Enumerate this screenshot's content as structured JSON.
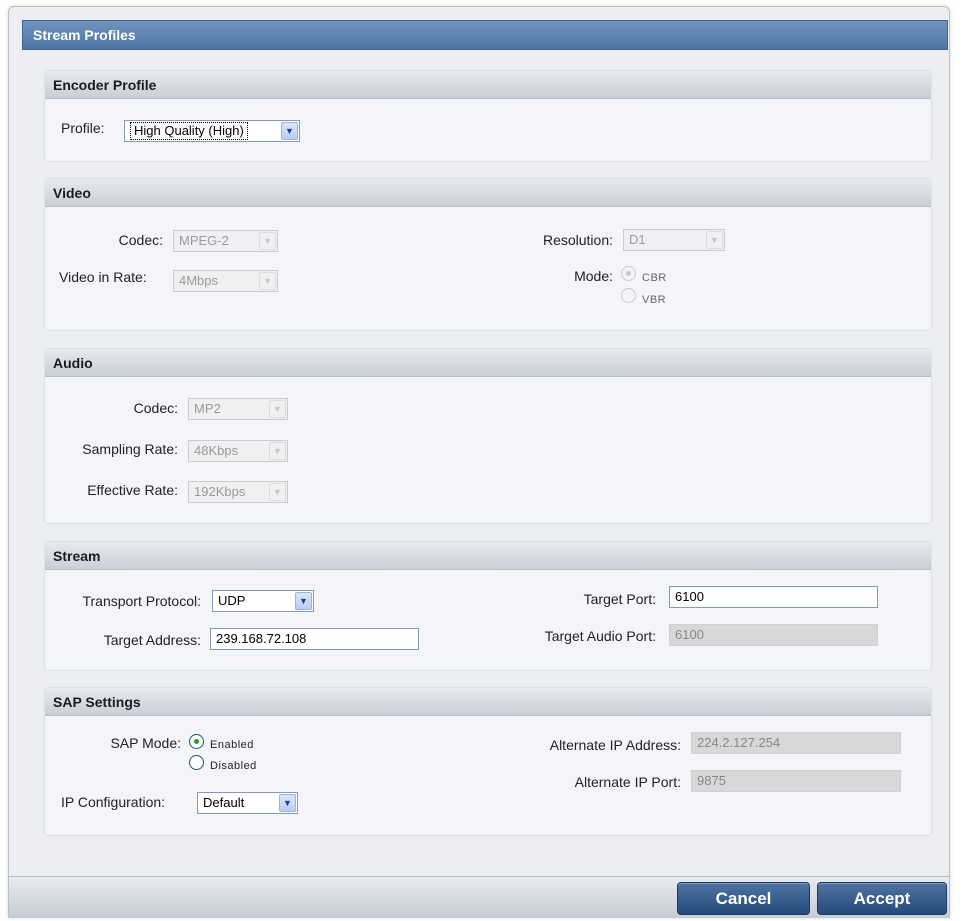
{
  "window": {
    "title": "Stream Profiles"
  },
  "encoder_profile": {
    "header": "Encoder Profile",
    "profile_label": "Profile:",
    "profile_value": "High Quality (High)"
  },
  "video": {
    "header": "Video",
    "codec_label": "Codec:",
    "codec_value": "MPEG-2",
    "rate_label": "Video in Rate:",
    "rate_value": "4Mbps",
    "resolution_label": "Resolution:",
    "resolution_value": "D1",
    "mode_label": "Mode:",
    "mode_options": [
      "CBR",
      "VBR"
    ],
    "mode_selected": "CBR"
  },
  "audio": {
    "header": "Audio",
    "codec_label": "Codec:",
    "codec_value": "MP2",
    "sampling_label": "Sampling Rate:",
    "sampling_value": "48Kbps",
    "effective_label": "Effective Rate:",
    "effective_value": "192Kbps"
  },
  "stream": {
    "header": "Stream",
    "protocol_label": "Transport Protocol:",
    "protocol_value": "UDP",
    "address_label": "Target Address:",
    "address_value": "239.168.72.108",
    "port_label": "Target Port:",
    "port_value": "6100",
    "audio_port_label": "Target Audio Port:",
    "audio_port_value": "6100"
  },
  "sap": {
    "header": "SAP Settings",
    "mode_label": "SAP Mode:",
    "mode_options": [
      "Enabled",
      "Disabled"
    ],
    "mode_selected": "Enabled",
    "ipconfig_label": "IP Configuration:",
    "ipconfig_value": "Default",
    "alt_ip_label": "Alternate IP Address:",
    "alt_ip_value": "224.2.127.254",
    "alt_port_label": "Alternate IP Port:",
    "alt_port_value": "9875"
  },
  "buttons": {
    "cancel": "Cancel",
    "accept": "Accept"
  },
  "colors": {
    "title_bar": "#5a80ae",
    "button": "#3a5f8f",
    "radio_checked": "#21a121"
  }
}
